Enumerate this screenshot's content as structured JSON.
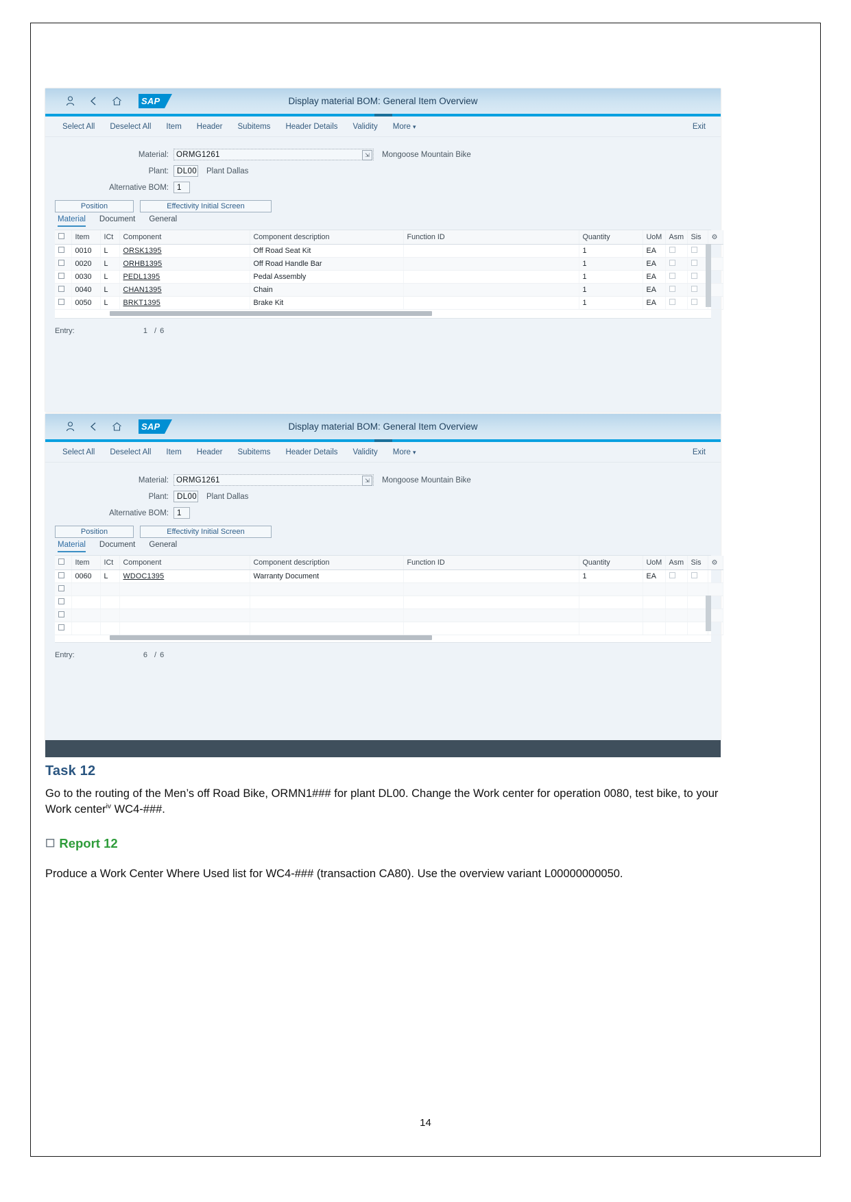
{
  "document": {
    "page_number": "14"
  },
  "sap_screens": [
    {
      "id": "screen-1",
      "shell": {
        "title": "Display material BOM: General Item Overview",
        "logo_text": "SAP",
        "icons": [
          "user-icon",
          "back-icon",
          "home-icon"
        ]
      },
      "toolbar": {
        "items": [
          "Select All",
          "Deselect All",
          "Item",
          "Header",
          "Subitems",
          "Header Details",
          "Validity",
          "More"
        ],
        "more_label": "More",
        "exit_label": "Exit"
      },
      "form": {
        "material_label": "Material:",
        "material_value": "ORMG1261",
        "material_description": "Mongoose Mountain Bike",
        "plant_label": "Plant:",
        "plant_value": "DL00",
        "plant_description": "Plant Dallas",
        "alt_bom_label": "Alternative BOM:",
        "alt_bom_value": "1"
      },
      "buttons": {
        "position": "Position",
        "effectivity": "Effectivity Initial Screen"
      },
      "tabs": [
        {
          "label": "Material",
          "active": true
        },
        {
          "label": "Document",
          "active": false
        },
        {
          "label": "General",
          "active": false
        }
      ],
      "table": {
        "columns": [
          "Item",
          "ICt",
          "Component",
          "Component description",
          "Function ID",
          "Quantity",
          "UoM",
          "Asm",
          "Sis"
        ],
        "rows": [
          {
            "item": "0010",
            "ict": "L",
            "component": "ORSK1395",
            "description": "Off Road Seat Kit",
            "function_id": "",
            "quantity": "1",
            "uom": "EA"
          },
          {
            "item": "0020",
            "ict": "L",
            "component": "ORHB1395",
            "description": "Off Road Handle Bar",
            "function_id": "",
            "quantity": "1",
            "uom": "EA"
          },
          {
            "item": "0030",
            "ict": "L",
            "component": "PEDL1395",
            "description": "Pedal Assembly",
            "function_id": "",
            "quantity": "1",
            "uom": "EA"
          },
          {
            "item": "0040",
            "ict": "L",
            "component": "CHAN1395",
            "description": "Chain",
            "function_id": "",
            "quantity": "1",
            "uom": "EA"
          },
          {
            "item": "0050",
            "ict": "L",
            "component": "BRKT1395",
            "description": "Brake Kit",
            "function_id": "",
            "quantity": "1",
            "uom": "EA"
          }
        ]
      },
      "entry": {
        "label": "Entry:",
        "current": "1",
        "separator": "/",
        "total": "6"
      }
    },
    {
      "id": "screen-2",
      "shell": {
        "title": "Display material BOM: General Item Overview",
        "logo_text": "SAP",
        "icons": [
          "user-icon",
          "back-icon",
          "home-icon"
        ]
      },
      "toolbar": {
        "items": [
          "Select All",
          "Deselect All",
          "Item",
          "Header",
          "Subitems",
          "Header Details",
          "Validity",
          "More"
        ],
        "more_label": "More",
        "exit_label": "Exit"
      },
      "form": {
        "material_label": "Material:",
        "material_value": "ORMG1261",
        "material_description": "Mongoose Mountain Bike",
        "plant_label": "Plant:",
        "plant_value": "DL00",
        "plant_description": "Plant Dallas",
        "alt_bom_label": "Alternative BOM:",
        "alt_bom_value": "1"
      },
      "buttons": {
        "position": "Position",
        "effectivity": "Effectivity Initial Screen"
      },
      "tabs": [
        {
          "label": "Material",
          "active": true
        },
        {
          "label": "Document",
          "active": false
        },
        {
          "label": "General",
          "active": false
        }
      ],
      "table": {
        "columns": [
          "Item",
          "ICt",
          "Component",
          "Component description",
          "Function ID",
          "Quantity",
          "UoM",
          "Asm",
          "Sis"
        ],
        "rows": [
          {
            "item": "0060",
            "ict": "L",
            "component": "WDOC1395",
            "description": "Warranty Document",
            "function_id": "",
            "quantity": "1",
            "uom": "EA"
          }
        ]
      },
      "entry": {
        "label": "Entry:",
        "current": "6",
        "separator": "/",
        "total": "6"
      }
    }
  ],
  "task": {
    "heading": "Task 12",
    "line1": "Go to the routing of the Men’s off Road Bike, ORMN1### for plant DL00. Change the Work center",
    "line2_pre": "for operation 0080, test bike, to your Work center",
    "line2_sup": "iv",
    "line2_post": " WC4-###."
  },
  "report": {
    "heading": "Report 12",
    "text": "Produce a Work Center Where Used list for WC4-### (transaction CA80). Use the overview variant L00000000050."
  }
}
